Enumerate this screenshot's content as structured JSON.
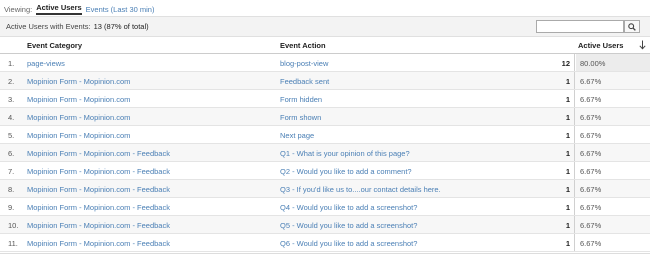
{
  "viewing": {
    "label": "Viewing:",
    "tabs": [
      {
        "label": "Active Users",
        "active": true
      },
      {
        "label": "Events (Last 30 min)",
        "active": false
      }
    ]
  },
  "summary": {
    "label": "Active Users with Events:",
    "value": "13 (87% of total)"
  },
  "search": {
    "placeholder": "",
    "icon": "search-icon"
  },
  "table": {
    "headers": {
      "category": "Event Category",
      "action": "Event Action",
      "users": "Active Users",
      "sort_icon": "arrow-down-icon"
    },
    "rows": [
      {
        "num": "1.",
        "category": "page-views",
        "action": "blog-post-view",
        "count": "12",
        "pct": "80.00%"
      },
      {
        "num": "2.",
        "category": "Mopinion Form - Mopinion.com",
        "action": "Feedback sent",
        "count": "1",
        "pct": "6.67%"
      },
      {
        "num": "3.",
        "category": "Mopinion Form - Mopinion.com",
        "action": "Form hidden",
        "count": "1",
        "pct": "6.67%"
      },
      {
        "num": "4.",
        "category": "Mopinion Form - Mopinion.com",
        "action": "Form shown",
        "count": "1",
        "pct": "6.67%"
      },
      {
        "num": "5.",
        "category": "Mopinion Form - Mopinion.com",
        "action": "Next page",
        "count": "1",
        "pct": "6.67%"
      },
      {
        "num": "6.",
        "category": "Mopinion Form - Mopinion.com - Feedback",
        "action": "Q1 - What is your opinion of this page?",
        "count": "1",
        "pct": "6.67%"
      },
      {
        "num": "7.",
        "category": "Mopinion Form - Mopinion.com - Feedback",
        "action": "Q2 - Would you like to add a comment?",
        "count": "1",
        "pct": "6.67%"
      },
      {
        "num": "8.",
        "category": "Mopinion Form - Mopinion.com - Feedback",
        "action": "Q3 - If you'd like us to....our contact details here.",
        "count": "1",
        "pct": "6.67%"
      },
      {
        "num": "9.",
        "category": "Mopinion Form - Mopinion.com - Feedback",
        "action": "Q4 - Would you like to add a screenshot?",
        "count": "1",
        "pct": "6.67%"
      },
      {
        "num": "10.",
        "category": "Mopinion Form - Mopinion.com - Feedback",
        "action": "Q5 - Would you like to add a screenshot?",
        "count": "1",
        "pct": "6.67%"
      },
      {
        "num": "11.",
        "category": "Mopinion Form - Mopinion.com - Feedback",
        "action": "Q6 - Would you like to add a screenshot?",
        "count": "1",
        "pct": "6.67%"
      }
    ]
  }
}
